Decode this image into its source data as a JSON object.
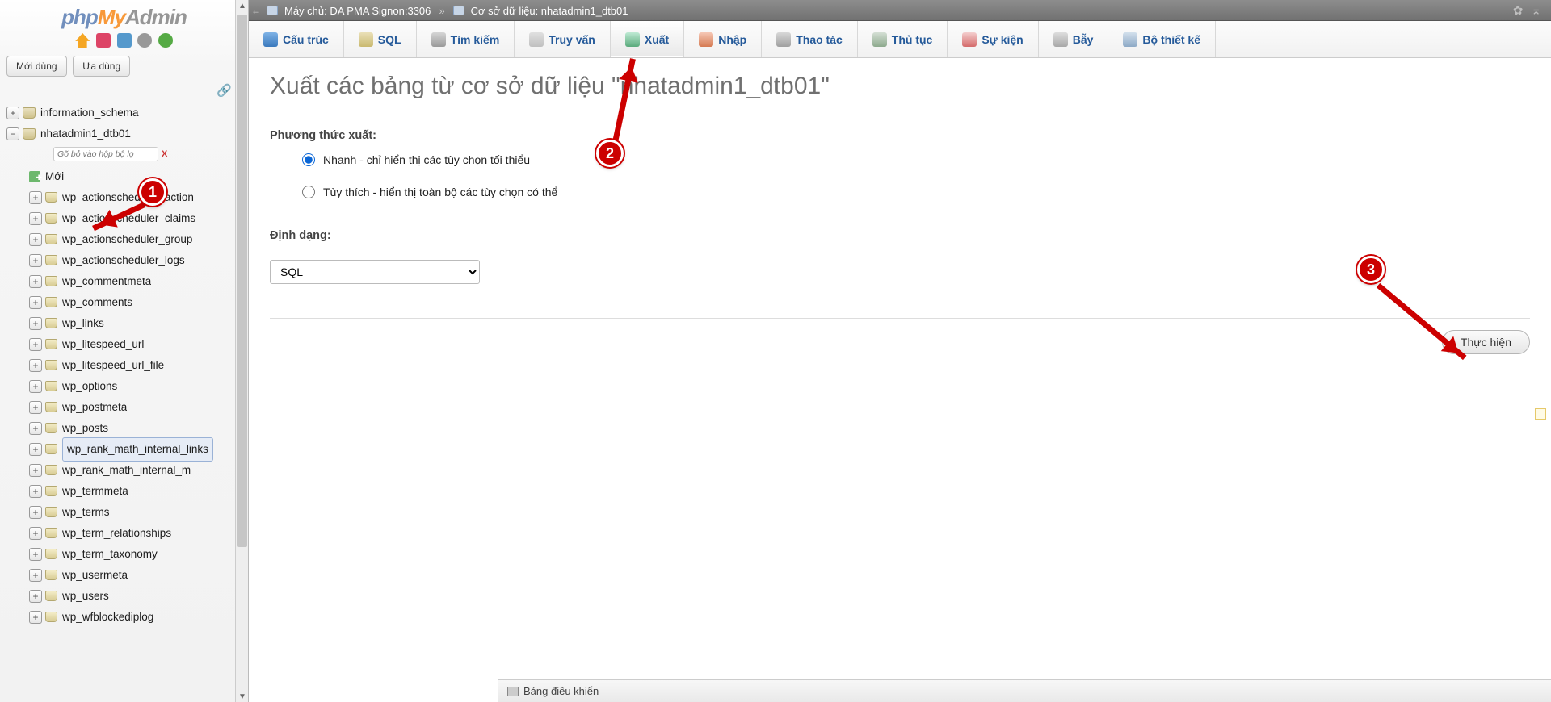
{
  "logo": {
    "p1": "php",
    "p2": "My",
    "p3": "Admin"
  },
  "subtabs": {
    "recent": "Mới dùng",
    "favorite": "Ưa dùng"
  },
  "filter_placeholder": "Gõ bỏ vào hộp bộ lọ",
  "tree": {
    "db1": "information_schema",
    "db2": "nhatadmin1_dtb01",
    "new_label": "Mới",
    "tables": [
      "wp_actionscheduler_action",
      "wp_actionscheduler_claims",
      "wp_actionscheduler_group",
      "wp_actionscheduler_logs",
      "wp_commentmeta",
      "wp_comments",
      "wp_links",
      "wp_litespeed_url",
      "wp_litespeed_url_file",
      "wp_options",
      "wp_postmeta",
      "wp_posts",
      "wp_rank_math_internal_links",
      "wp_rank_math_internal_m",
      "wp_termmeta",
      "wp_terms",
      "wp_term_relationships",
      "wp_term_taxonomy",
      "wp_usermeta",
      "wp_users",
      "wp_wfblockediplog"
    ],
    "highlight_index": 12
  },
  "breadcrumb": {
    "server_label": "Máy chủ: DA PMA Signon:3306",
    "db_label": "Cơ sở dữ liệu: nhatadmin1_dtb01"
  },
  "tabs": [
    {
      "key": "structure",
      "label": "Cấu trúc",
      "active": false
    },
    {
      "key": "sql",
      "label": "SQL",
      "active": false
    },
    {
      "key": "search",
      "label": "Tìm kiếm",
      "active": false
    },
    {
      "key": "query",
      "label": "Truy vấn",
      "active": false
    },
    {
      "key": "export",
      "label": "Xuất",
      "active": true
    },
    {
      "key": "import",
      "label": "Nhập",
      "active": false
    },
    {
      "key": "operations",
      "label": "Thao tác",
      "active": false
    },
    {
      "key": "routines",
      "label": "Thủ tục",
      "active": false
    },
    {
      "key": "events",
      "label": "Sự kiện",
      "active": false
    },
    {
      "key": "triggers",
      "label": "Bẫy",
      "active": false
    },
    {
      "key": "designer",
      "label": "Bộ thiết kế",
      "active": false
    }
  ],
  "page": {
    "title": "Xuất các bảng từ cơ sở dữ liệu \"nhatadmin1_dtb01\"",
    "method_heading": "Phương thức xuất:",
    "method_quick": "Nhanh - chỉ hiển thị các tùy chọn tối thiểu",
    "method_custom": "Tùy thích - hiển thị toàn bộ các tùy chọn có thể",
    "format_heading": "Định dạng:",
    "format_value": "SQL",
    "submit": "Thực hiện"
  },
  "footer": {
    "console": "Bảng điều khiển"
  },
  "annotations": {
    "b1": "1",
    "b2": "2",
    "b3": "3"
  }
}
